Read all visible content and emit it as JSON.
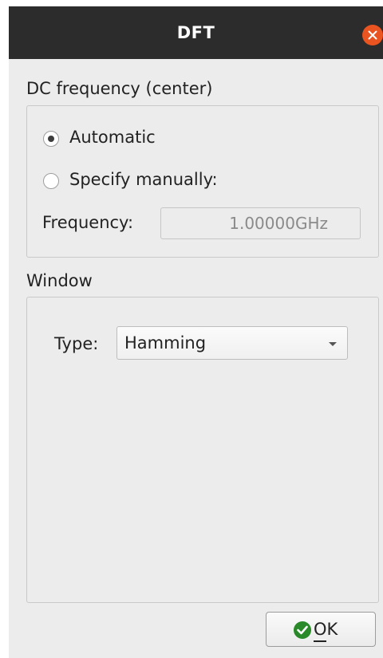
{
  "window": {
    "title": "DFT"
  },
  "dc_frequency": {
    "section_label": "DC frequency (center)",
    "options": [
      {
        "label": "Automatic",
        "selected": true
      },
      {
        "label": "Specify manually:",
        "selected": false
      }
    ],
    "frequency_label": "Frequency:",
    "frequency_value": "1.00000GHz"
  },
  "window_section": {
    "section_label": "Window",
    "type_label": "Type:",
    "type_value": "Hamming"
  },
  "buttons": {
    "ok_label": "OK"
  },
  "colors": {
    "titlebar": "#2c2c2c",
    "close_button": "#e95420",
    "ok_icon": "#2a8a2a",
    "background": "#ececec"
  },
  "icons": {
    "close": "close-icon",
    "ok": "checkmark-icon",
    "dropdown": "chevron-down-icon"
  }
}
